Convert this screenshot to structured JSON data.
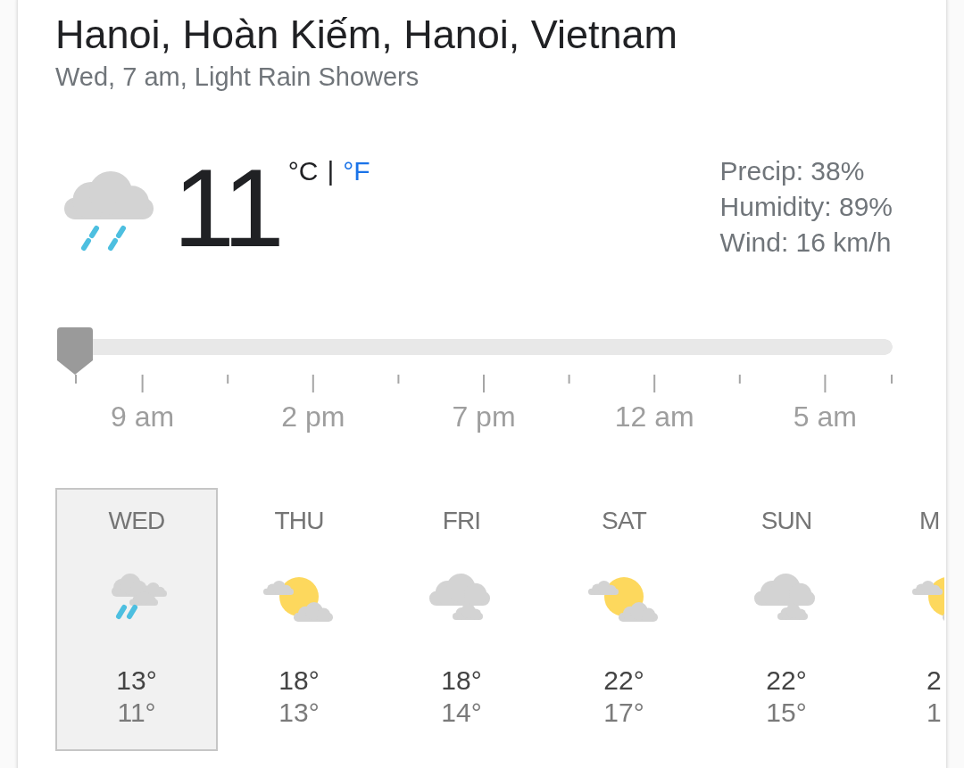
{
  "location": {
    "title": "Hanoi, Hoàn Kiếm, Hanoi, Vietnam",
    "subtitle": "Wed, 7 am, Light Rain Showers"
  },
  "current": {
    "temperature": "11",
    "units": [
      {
        "label": "°C",
        "selected": true
      },
      {
        "label": "°F",
        "selected": false
      }
    ],
    "unit_separator": "|",
    "details": [
      "Precip: 38%",
      "Humidity: 89%",
      "Wind: 16 km/h"
    ]
  },
  "hourly": {
    "slider": {
      "level": 0
    },
    "labels": [
      "9 am",
      "2 pm",
      "7 pm",
      "12 am",
      "5 am"
    ]
  },
  "days": [
    {
      "label": "WED",
      "kind": "rain",
      "high": "13°",
      "low": "11°",
      "selected": true,
      "clipped": false
    },
    {
      "label": "THU",
      "kind": "partly_sunny",
      "high": "18°",
      "low": "13°",
      "selected": false,
      "clipped": false
    },
    {
      "label": "FRI",
      "kind": "cloudy",
      "high": "18°",
      "low": "14°",
      "selected": false,
      "clipped": false
    },
    {
      "label": "SAT",
      "kind": "partly_sunny",
      "high": "22°",
      "low": "17°",
      "selected": false,
      "clipped": false
    },
    {
      "label": "SUN",
      "kind": "cloudy",
      "high": "22°",
      "low": "15°",
      "selected": false,
      "clipped": false
    },
    {
      "label": "M",
      "kind": "partly_sunny",
      "high": "2",
      "low": "1",
      "selected": false,
      "clipped": true
    }
  ]
}
